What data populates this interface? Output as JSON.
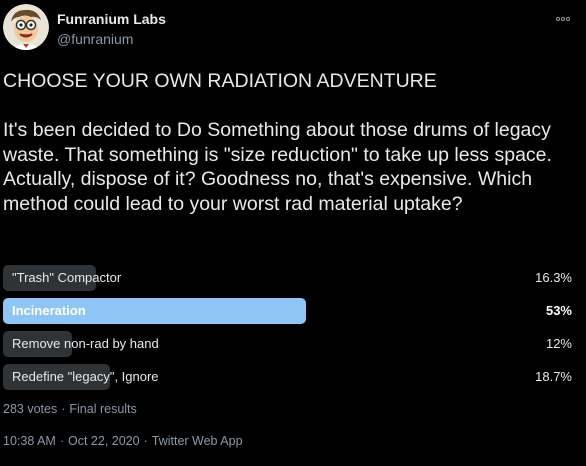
{
  "author": {
    "name": "Funranium Labs",
    "handle": "@funranium",
    "avatar_icon": "cartoon-scientist-avatar"
  },
  "tweet": {
    "headline": "CHOOSE YOUR OWN RADIATION ADVENTURE",
    "body": "It's been decided to Do Something about those drums of legacy waste. That something is \"size reduction\" to take up less space. Actually, dispose of it? Goodness no, that's expensive. Which method could lead to your worst rad material uptake?"
  },
  "poll": {
    "options": [
      {
        "label": "\"Trash\" Compactor",
        "percent_text": "16.3%",
        "percent": 16.3,
        "winner": false
      },
      {
        "label": "Incineration",
        "percent_text": "53%",
        "percent": 53,
        "winner": true
      },
      {
        "label": "Remove non-rad by hand",
        "percent_text": "12%",
        "percent": 12,
        "winner": false
      },
      {
        "label": "Redefine \"legacy\", Ignore",
        "percent_text": "18.7%",
        "percent": 18.7,
        "winner": false
      }
    ],
    "votes_text": "283 votes",
    "status_text": "Final results"
  },
  "meta": {
    "time": "10:38 AM",
    "date": "Oct 22, 2020",
    "source": "Twitter Web App"
  },
  "colors": {
    "background": "#000000",
    "winner_bar": "#8ec5f5",
    "other_bar": "#2f3336",
    "secondary_text": "#8b98a5"
  },
  "icons": {
    "more": "more-options-icon"
  }
}
